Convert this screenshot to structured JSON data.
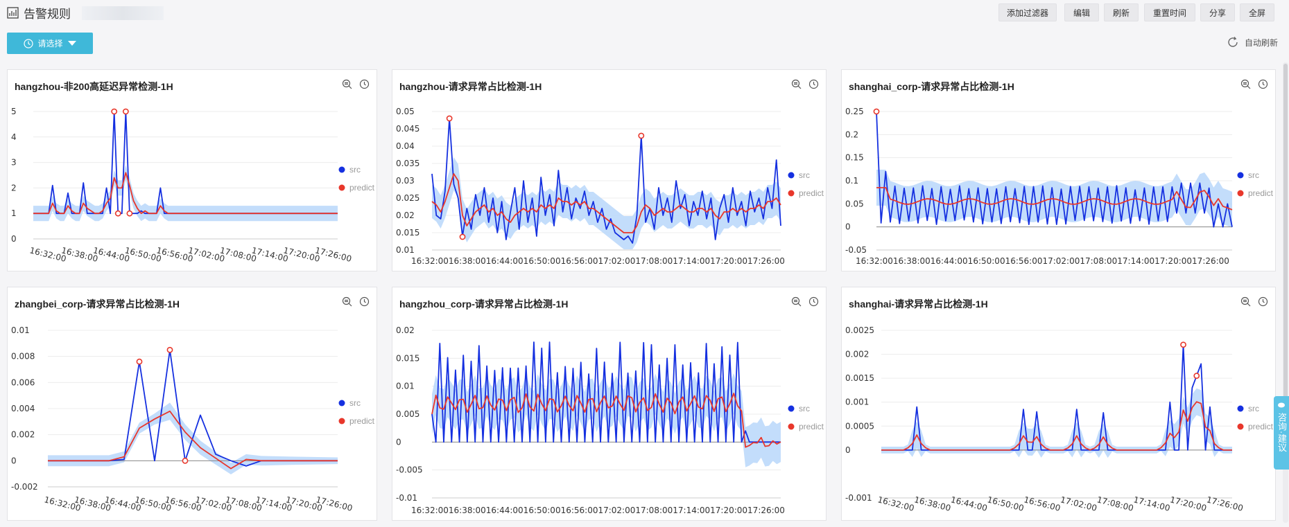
{
  "header": {
    "title": "告警规则",
    "buttons": [
      "添加过滤器",
      "编辑",
      "刷新",
      "重置时间",
      "分享",
      "全屏"
    ]
  },
  "toolbar": {
    "select_label": "请选择",
    "auto_refresh_label": "自动刷新"
  },
  "side_tab": {
    "label": "咨询·建议"
  },
  "colors": {
    "src": "#1530e0",
    "predict": "#e8372b",
    "band": "#b9d7fa",
    "accent": "#3fb8d9"
  },
  "legend": {
    "src": "src",
    "predict": "predict"
  },
  "panel_icons": [
    "zoom-icon",
    "clock-icon"
  ],
  "chart_data": [
    {
      "type": "line",
      "title": "hangzhou-非200高延迟异常检测-1H",
      "x": [
        "16:32:00",
        "16:38:00",
        "16:44:00",
        "16:50:00",
        "16:56:00",
        "17:02:00",
        "17:08:00",
        "17:14:00",
        "17:20:00",
        "17:26:00"
      ],
      "y_ticks": [
        "0",
        "1",
        "2",
        "3",
        "4",
        "5"
      ],
      "ylim": [
        0,
        5
      ],
      "series": [
        {
          "name": "src",
          "values": [
            1,
            1,
            1,
            1,
            1,
            2.1,
            1,
            1,
            1,
            1.8,
            1,
            1,
            1,
            2.2,
            1,
            1,
            1,
            1,
            1,
            2,
            1,
            5,
            1,
            1,
            5,
            1,
            1,
            1,
            1.1,
            1,
            1,
            1,
            1,
            2,
            1,
            1,
            1,
            1,
            1,
            1,
            1,
            1,
            1,
            1,
            1,
            1,
            1,
            1,
            1,
            1,
            1,
            1,
            1,
            1,
            1,
            1,
            1,
            1,
            1,
            1,
            1,
            1,
            1,
            1,
            1,
            1,
            1,
            1,
            1,
            1,
            1,
            1,
            1,
            1,
            1,
            1,
            1,
            1,
            1,
            1
          ]
        },
        {
          "name": "predict",
          "values": [
            1,
            1,
            1,
            1,
            1,
            1.4,
            1.1,
            1,
            1,
            1.3,
            1.1,
            1,
            1,
            1.4,
            1.2,
            1.1,
            1,
            1,
            1.1,
            1.4,
            1.6,
            2.4,
            2,
            2,
            2.6,
            2.1,
            1.5,
            1.2,
            1,
            1.1,
            1,
            1,
            1,
            1.3,
            1.1,
            1,
            1,
            1,
            1,
            1,
            1,
            1,
            1,
            1,
            1,
            1,
            1,
            1,
            1,
            1,
            1,
            1,
            1,
            1,
            1,
            1,
            1,
            1,
            1,
            1,
            1,
            1,
            1,
            1,
            1,
            1,
            1,
            1,
            1,
            1,
            1,
            1,
            1,
            1,
            1,
            1,
            1,
            1,
            1,
            1
          ]
        }
      ],
      "anomalies": [
        {
          "i": 21,
          "v": 5
        },
        {
          "i": 24,
          "v": 5
        },
        {
          "i": 22,
          "v": 1
        },
        {
          "i": 25,
          "v": 1
        }
      ]
    },
    {
      "type": "line",
      "title": "hangzhou-请求异常占比检测-1H",
      "x": [
        "16:32:00",
        "16:38:00",
        "16:44:00",
        "16:50:00",
        "16:56:00",
        "17:02:00",
        "17:08:00",
        "17:14:00",
        "17:20:00",
        "17:26:00"
      ],
      "x_concatenated": true,
      "y_ticks": [
        "0.01",
        "0.015",
        "0.02",
        "0.025",
        "0.03",
        "0.035",
        "0.04",
        "0.045",
        "0.05"
      ],
      "ylim": [
        0.01,
        0.05
      ],
      "series": [
        {
          "name": "src",
          "values": [
            0.032,
            0.02,
            0.019,
            0.027,
            0.048,
            0.029,
            0.025,
            0.014,
            0.022,
            0.016,
            0.026,
            0.02,
            0.028,
            0.018,
            0.025,
            0.015,
            0.024,
            0.013,
            0.021,
            0.028,
            0.016,
            0.03,
            0.018,
            0.025,
            0.014,
            0.031,
            0.02,
            0.026,
            0.017,
            0.033,
            0.021,
            0.028,
            0.019,
            0.025,
            0.022,
            0.027,
            0.02,
            0.024,
            0.018,
            0.022,
            0.016,
            0.019,
            0.015,
            0.014,
            0.013,
            0.014,
            0.012,
            0.02,
            0.043,
            0.018,
            0.022,
            0.016,
            0.028,
            0.02,
            0.025,
            0.018,
            0.03,
            0.022,
            0.026,
            0.017,
            0.024,
            0.02,
            0.027,
            0.019,
            0.025,
            0.013,
            0.022,
            0.026,
            0.018,
            0.028,
            0.02,
            0.024,
            0.017,
            0.027,
            0.021,
            0.025,
            0.019,
            0.028,
            0.022,
            0.036,
            0.017
          ]
        },
        {
          "name": "predict",
          "values": [
            0.024,
            0.023,
            0.021,
            0.024,
            0.028,
            0.032,
            0.03,
            0.02,
            0.017,
            0.019,
            0.021,
            0.022,
            0.023,
            0.021,
            0.022,
            0.02,
            0.021,
            0.019,
            0.018,
            0.02,
            0.021,
            0.022,
            0.021,
            0.022,
            0.021,
            0.023,
            0.022,
            0.023,
            0.022,
            0.025,
            0.024,
            0.024,
            0.023,
            0.024,
            0.023,
            0.024,
            0.022,
            0.022,
            0.021,
            0.02,
            0.019,
            0.018,
            0.017,
            0.016,
            0.015,
            0.015,
            0.015,
            0.017,
            0.021,
            0.023,
            0.022,
            0.02,
            0.021,
            0.022,
            0.021,
            0.021,
            0.022,
            0.023,
            0.022,
            0.021,
            0.021,
            0.022,
            0.022,
            0.021,
            0.022,
            0.02,
            0.019,
            0.021,
            0.021,
            0.022,
            0.021,
            0.022,
            0.021,
            0.022,
            0.022,
            0.023,
            0.022,
            0.024,
            0.024,
            0.025,
            0.023
          ]
        }
      ],
      "anomalies": [
        {
          "i": 4,
          "v": 0.048
        },
        {
          "i": 7,
          "v": 0.0138
        },
        {
          "i": 48,
          "v": 0.043
        }
      ]
    },
    {
      "type": "line",
      "title": "shanghai_corp-请求异常占比检测-1H",
      "x": [
        "16:32:00",
        "16:38:00",
        "16:44:00",
        "16:50:00",
        "16:56:00",
        "17:02:00",
        "17:08:00",
        "17:14:00",
        "17:20:00",
        "17:26:00"
      ],
      "x_concatenated": true,
      "y_ticks": [
        "-0.05",
        "0",
        "0.05",
        "0.1",
        "0.15",
        "0.2",
        "0.25"
      ],
      "ylim": [
        -0.05,
        0.25
      ],
      "series": [
        {
          "name": "src",
          "pattern": "sawtooth",
          "peak": 0.08,
          "first": 0.25,
          "values_note": "alternating 0 / ~0.08 with spike near 17:14"
        },
        {
          "name": "predict",
          "values": "smooth ~0.06"
        }
      ],
      "anomalies": [
        {
          "i": 0,
          "v": 0.25
        }
      ]
    },
    {
      "type": "line",
      "title": "zhangbei_corp-请求异常占比检测-1H",
      "x": [
        "16:32:00",
        "16:38:00",
        "16:44:00",
        "16:50:00",
        "16:56:00",
        "17:02:00",
        "17:08:00",
        "17:14:00",
        "17:20:00",
        "17:26:00"
      ],
      "y_ticks": [
        "-0.002",
        "0",
        "0.002",
        "0.004",
        "0.006",
        "0.008",
        "0.01"
      ],
      "ylim": [
        -0.002,
        0.01
      ],
      "series": [
        {
          "name": "src",
          "values": [
            0,
            0,
            0,
            0,
            0,
            0.0001,
            0.0076,
            0,
            0.0085,
            0,
            0.0035,
            0.0005,
            0,
            -0.0004,
            0,
            0,
            0,
            0,
            0,
            0
          ]
        },
        {
          "name": "predict",
          "values": [
            0,
            0,
            0,
            0,
            0,
            0.0003,
            0.0025,
            0.0032,
            0.0038,
            0.0022,
            0.001,
            0.0002,
            -0.0006,
            0.0001,
            0,
            0,
            0,
            0,
            0,
            0
          ]
        }
      ],
      "anomalies": [
        {
          "i": 6,
          "v": 0.0076
        },
        {
          "i": 8,
          "v": 0.0085
        },
        {
          "i": 9,
          "v": 0
        }
      ]
    },
    {
      "type": "line",
      "title": "hangzhou_corp-请求异常占比检测-1H",
      "x": [
        "16:32:00",
        "16:38:00",
        "16:44:00",
        "16:50:00",
        "16:56:00",
        "17:02:00",
        "17:08:00",
        "17:14:00",
        "17:20:00",
        "17:26:00"
      ],
      "x_concatenated": true,
      "y_ticks": [
        "-0.01",
        "-0.005",
        "0",
        "0.005",
        "0.01",
        "0.015",
        "0.02"
      ],
      "ylim": [
        -0.01,
        0.02
      ],
      "series": [
        {
          "name": "src",
          "pattern": "square-wave 0 / ~0.015"
        },
        {
          "name": "predict",
          "pattern": "oscillating ~0.007"
        }
      ],
      "anomalies": []
    },
    {
      "type": "line",
      "title": "shanghai-请求异常占比检测-1H",
      "x": [
        "16:32:00",
        "16:38:00",
        "16:44:00",
        "16:50:00",
        "16:56:00",
        "17:02:00",
        "17:08:00",
        "17:14:00",
        "17:20:00",
        "17:26:00"
      ],
      "y_ticks": [
        "-0.001",
        "0",
        "0.0005",
        "0.001",
        "0.0015",
        "0.002",
        "0.0025"
      ],
      "ylim": [
        -0.001,
        0.0025
      ],
      "series": [
        {
          "name": "src",
          "pattern": "mostly 0 with spikes up to ~0.0022"
        },
        {
          "name": "predict",
          "pattern": "smoothed spikes"
        }
      ],
      "anomalies": [
        {
          "i": 68,
          "v": 0.0022
        },
        {
          "i": 71,
          "v": 0.00155
        }
      ]
    }
  ]
}
